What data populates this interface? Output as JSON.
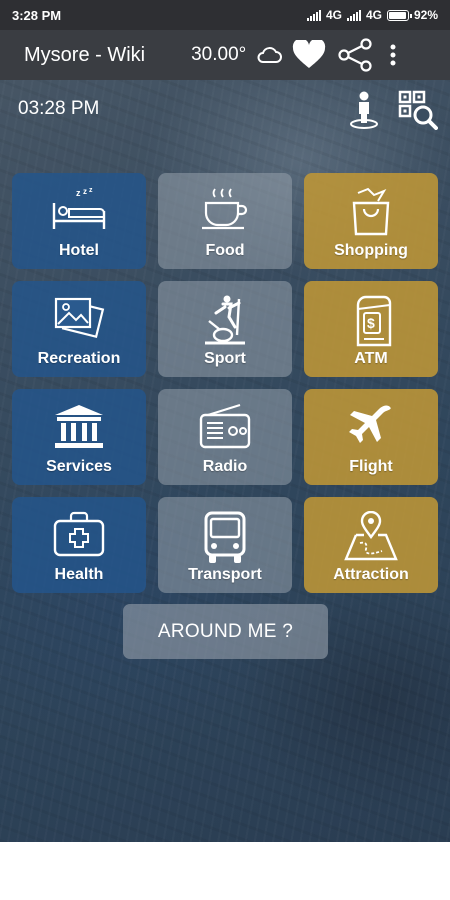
{
  "status_bar": {
    "time": "3:28 PM",
    "net1": "4G",
    "net2": "4G",
    "battery": "92%",
    "battery_level": 0.92
  },
  "app_bar": {
    "title": "Mysore - Wiki",
    "temperature": "30.00°",
    "icons": [
      "cloud-icon",
      "heart-icon",
      "share-icon",
      "more-vert-icon"
    ]
  },
  "header": {
    "time": "03:28 PM",
    "icons": [
      "person-pin-icon",
      "qr-search-icon"
    ]
  },
  "categories": [
    {
      "label": "Hotel",
      "icon": "bed-icon",
      "color": "#23558c"
    },
    {
      "label": "Food",
      "icon": "coffee-cup-icon",
      "color": "#96a0ac"
    },
    {
      "label": "Shopping",
      "icon": "shopping-bag-icon",
      "color": "#be9637"
    },
    {
      "label": "Recreation",
      "icon": "photos-icon",
      "color": "#23558c"
    },
    {
      "label": "Sport",
      "icon": "elliptical-trainer-icon",
      "color": "#96a0ac"
    },
    {
      "label": "ATM",
      "icon": "atm-machine-icon",
      "color": "#be9637"
    },
    {
      "label": "Services",
      "icon": "bank-building-icon",
      "color": "#23558c"
    },
    {
      "label": "Radio",
      "icon": "radio-icon",
      "color": "#96a0ac"
    },
    {
      "label": "Flight",
      "icon": "airplane-icon",
      "color": "#be9637"
    },
    {
      "label": "Health",
      "icon": "first-aid-kit-icon",
      "color": "#23558c"
    },
    {
      "label": "Transport",
      "icon": "bus-icon",
      "color": "#96a0ac"
    },
    {
      "label": "Attraction",
      "icon": "map-pin-icon",
      "color": "#be9637"
    }
  ],
  "around_me": {
    "label": "AROUND ME ?"
  }
}
